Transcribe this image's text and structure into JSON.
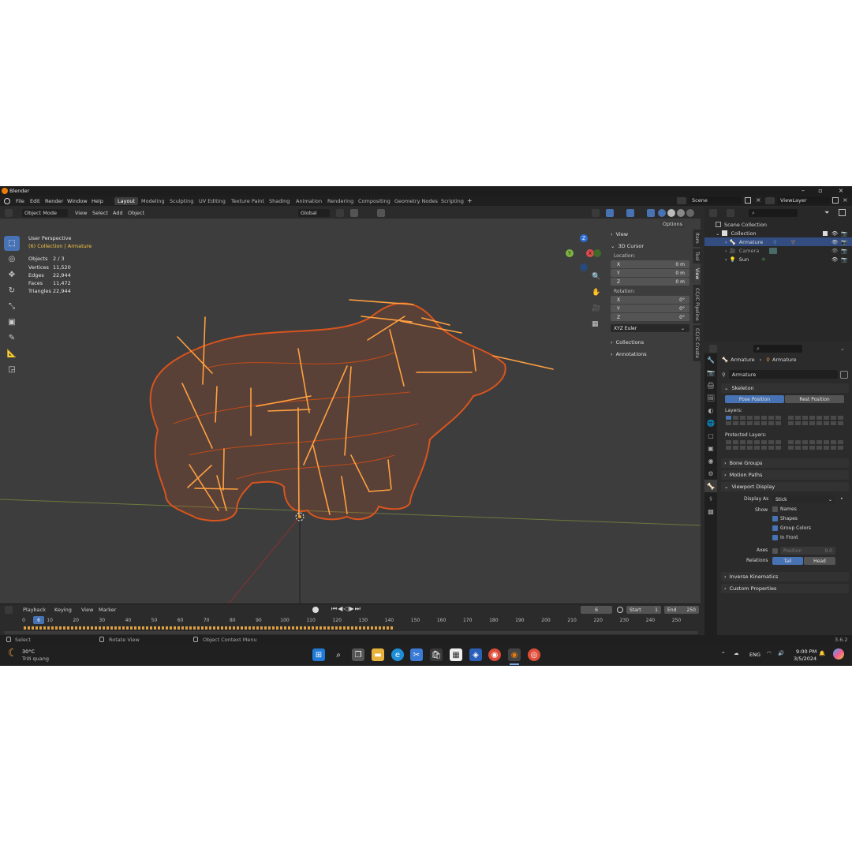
{
  "window": {
    "title": "Blender",
    "version": "3.6.2"
  },
  "menu": [
    "File",
    "Edit",
    "Render",
    "Window",
    "Help"
  ],
  "workspaces": [
    {
      "label": "Layout",
      "active": true
    },
    {
      "label": "Modeling"
    },
    {
      "label": "Sculpting"
    },
    {
      "label": "UV Editing"
    },
    {
      "label": "Texture Paint"
    },
    {
      "label": "Shading"
    },
    {
      "label": "Animation"
    },
    {
      "label": "Rendering"
    },
    {
      "label": "Compositing"
    },
    {
      "label": "Geometry Nodes"
    },
    {
      "label": "Scripting"
    }
  ],
  "scene_field": "Scene",
  "viewlayer_field": "ViewLayer",
  "viewport_header": {
    "mode": "Object Mode",
    "menus": [
      "View",
      "Select",
      "Add",
      "Object"
    ],
    "orientation": "Global",
    "options": "Options"
  },
  "viewport_overlay": {
    "perspective": "User Perspective",
    "collection": "(6) Collection | Armature",
    "stats": [
      {
        "label": "Objects",
        "value": "2 / 3"
      },
      {
        "label": "Vertices",
        "value": "11,520"
      },
      {
        "label": "Edges",
        "value": "22,944"
      },
      {
        "label": "Faces",
        "value": "11,472"
      },
      {
        "label": "Triangles",
        "value": "22,944"
      }
    ]
  },
  "npanel": {
    "view": "View",
    "cursor_title": "3D Cursor",
    "location_label": "Location:",
    "location": [
      {
        "axis": "X",
        "value": "0 m"
      },
      {
        "axis": "Y",
        "value": "0 m"
      },
      {
        "axis": "Z",
        "value": "0 m"
      }
    ],
    "rotation_label": "Rotation:",
    "rotation": [
      {
        "axis": "X",
        "value": "0°"
      },
      {
        "axis": "Y",
        "value": "0°"
      },
      {
        "axis": "Z",
        "value": "0°"
      }
    ],
    "rotation_mode": "XYZ Euler",
    "collections": "Collections",
    "annotations": "Annotations",
    "tabs": [
      "Item",
      "Tool",
      "View",
      "CC/iC Pipeline",
      "CC/iC Create"
    ]
  },
  "timeline": {
    "menus": [
      "Playback",
      "Keying",
      "View",
      "Marker"
    ],
    "current_frame": "6",
    "start_label": "Start",
    "start": "1",
    "end_label": "End",
    "end": "250",
    "ticks": [
      "0",
      "10",
      "20",
      "30",
      "40",
      "50",
      "60",
      "70",
      "80",
      "90",
      "100",
      "110",
      "120",
      "130",
      "140",
      "150",
      "160",
      "170",
      "180",
      "190",
      "200",
      "210",
      "220",
      "230",
      "240",
      "250"
    ]
  },
  "statusbar": {
    "select": "Select",
    "rotate": "Rotate View",
    "context": "Object Context Menu"
  },
  "outliner": {
    "rows": [
      {
        "label": "Scene Collection"
      },
      {
        "label": "Collection"
      },
      {
        "label": "Armature"
      },
      {
        "label": "Camera"
      },
      {
        "label": "Sun"
      }
    ]
  },
  "properties": {
    "breadcrumb_a": "Armature",
    "breadcrumb_b": "Armature",
    "name": "Armature",
    "skeleton": "Skeleton",
    "pose_position": "Pose Position",
    "rest_position": "Rest Position",
    "layers": "Layers:",
    "protected_layers": "Protected Layers:",
    "bone_groups": "Bone Groups",
    "motion_paths": "Motion Paths",
    "viewport_display": "Viewport Display",
    "display_as_label": "Display As",
    "display_as": "Stick",
    "show_label": "Show",
    "names": "Names",
    "shapes": "Shapes",
    "group_colors": "Group Colors",
    "in_front": "In Front",
    "axes_label": "Axes",
    "position_label": "Position",
    "position_value": "0.0",
    "relations_label": "Relations",
    "tail": "Tail",
    "head": "Head",
    "inverse_kinematics": "Inverse Kinematics",
    "custom_properties": "Custom Properties"
  },
  "taskbar": {
    "weather_temp": "30°C",
    "weather_desc": "Trời quang",
    "lang": "ENG",
    "time": "9:00 PM",
    "date": "3/5/2024"
  },
  "colors": {
    "accent": "#4772b3",
    "armature": "#ffa040",
    "mesh": "#d9541e"
  }
}
